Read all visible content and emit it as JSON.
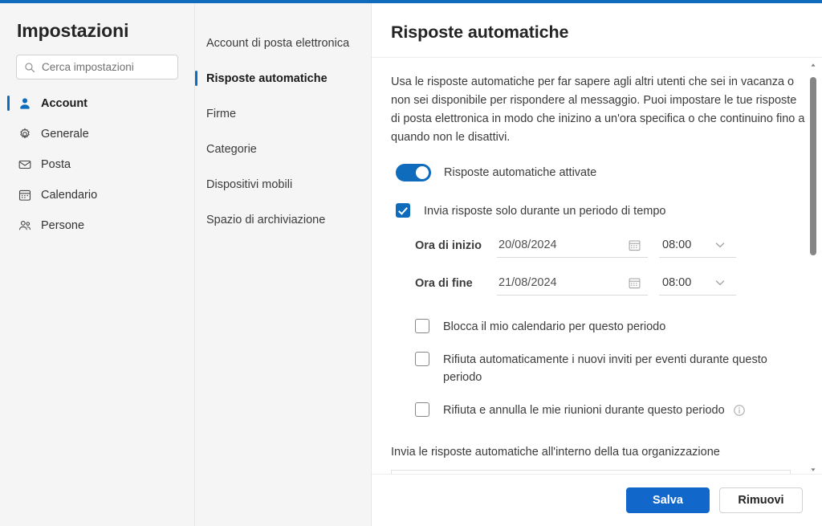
{
  "accent_color": "#0f6cbd",
  "settings_panel": {
    "title": "Impostazioni",
    "search": {
      "placeholder": "Cerca impostazioni",
      "value": "",
      "icon": "search-icon"
    },
    "nav_items": [
      {
        "label": "Account",
        "icon": "person-icon",
        "active": true
      },
      {
        "label": "Generale",
        "icon": "gear-icon",
        "active": false
      },
      {
        "label": "Posta",
        "icon": "envelope-icon",
        "active": false
      },
      {
        "label": "Calendario",
        "icon": "calendar-icon",
        "active": false
      },
      {
        "label": "Persone",
        "icon": "people-icon",
        "active": false
      }
    ]
  },
  "sub_nav": {
    "items": [
      {
        "label": "Account di posta elettronica",
        "active": false
      },
      {
        "label": "Risposte automatiche",
        "active": true
      },
      {
        "label": "Firme",
        "active": false
      },
      {
        "label": "Categorie",
        "active": false
      },
      {
        "label": "Dispositivi mobili",
        "active": false
      },
      {
        "label": "Spazio di archiviazione",
        "active": false
      }
    ]
  },
  "main": {
    "title": "Risposte automatiche",
    "intro": "Usa le risposte automatiche per far sapere agli altri utenti che sei in vacanza o non sei disponibile per rispondere al messaggio. Puoi impostare le tue risposte di posta elettronica in modo che inizino a un'ora specifica o che continuino fino a quando non le disattivi.",
    "toggle": {
      "label": "Risposte automatiche attivate",
      "state": "on"
    },
    "period_checkbox": {
      "label": "Invia risposte solo durante un periodo di tempo",
      "checked": true
    },
    "start": {
      "label": "Ora di inizio",
      "date": "20/08/2024",
      "time": "08:00",
      "date_icon": "calendar-icon",
      "time_icon": "chevron-down-icon"
    },
    "end": {
      "label": "Ora di fine",
      "date": "21/08/2024",
      "time": "08:00",
      "date_icon": "calendar-icon",
      "time_icon": "chevron-down-icon"
    },
    "options": [
      {
        "label": "Blocca il mio calendario per questo periodo",
        "checked": false,
        "info": false
      },
      {
        "label": "Rifiuta automaticamente i nuovi inviti per eventi durante questo periodo",
        "checked": false,
        "info": false
      },
      {
        "label": "Rifiuta e annulla le mie riunioni durante questo periodo",
        "checked": false,
        "info": true
      }
    ],
    "org_label": "Invia le risposte automatiche all'interno della tua organizzazione",
    "editor_value": ""
  },
  "footer": {
    "save_label": "Salva",
    "remove_label": "Rimuovi"
  },
  "scrollbar": {
    "up_icon": "triangle-up-icon",
    "down_icon": "triangle-down-icon"
  }
}
